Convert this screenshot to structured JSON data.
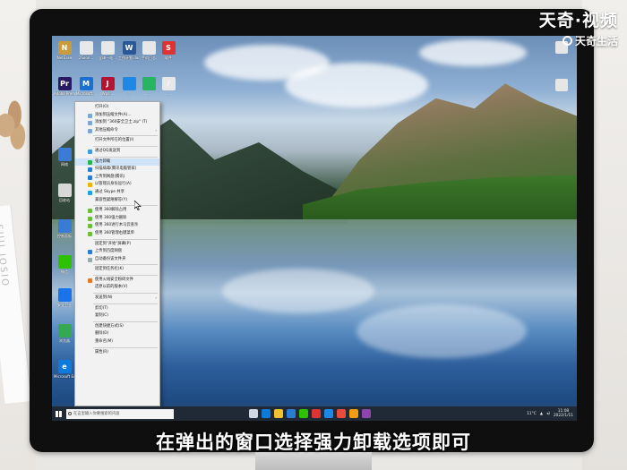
{
  "brand": {
    "logo_text": "天奇·视频",
    "sub_text": "天奇生活"
  },
  "subtitle": "在弹出的窗口选择强力卸载选项即可",
  "backdrop": {
    "paper_text": "SUJI JOSIO"
  },
  "desktop_icons": [
    {
      "label": "NetEase",
      "color": "#c89b3c",
      "glyph": "N"
    },
    {
      "label": "2Soon...",
      "color": "#e8e8e8",
      "glyph": ""
    },
    {
      "label": "全球一站...",
      "color": "#e8e8e8",
      "glyph": ""
    },
    {
      "label": "工作计划.docx",
      "color": "#2b5797",
      "glyph": "W"
    },
    {
      "label": "手机日志",
      "color": "#e8e8e8",
      "glyph": ""
    },
    {
      "label": "软件",
      "color": "#d33",
      "glyph": "S"
    },
    {
      "label": "Adobe Premie...",
      "color": "#2a1a63",
      "glyph": "Pr"
    },
    {
      "label": "Microsoft...",
      "color": "#1a6fd0",
      "glyph": "M"
    },
    {
      "label": "Wps...",
      "color": "#b5132f",
      "glyph": "J"
    },
    {
      "label": "...",
      "color": "#1e88e5",
      "glyph": ""
    },
    {
      "label": "...",
      "color": "#28b463",
      "glyph": ""
    },
    {
      "label": "...",
      "color": "#e8e8e8",
      "glyph": "/"
    },
    {
      "label": "网络",
      "color": "#3a7bd5",
      "glyph": ""
    },
    {
      "label": "回收站",
      "color": "#d8d8d8",
      "glyph": ""
    },
    {
      "label": "控制面板",
      "color": "#3a7bd5",
      "glyph": ""
    },
    {
      "label": "微信",
      "color": "#2dc100",
      "glyph": ""
    },
    {
      "label": "安全卫士",
      "color": "#1a73e8",
      "glyph": ""
    },
    {
      "label": "浏览器",
      "color": "#34a853",
      "glyph": ""
    },
    {
      "label": "Microsoft Edge",
      "color": "#0c7bdc",
      "glyph": "e"
    },
    {
      "label": "Edge",
      "color": "#0c7bdc",
      "glyph": "e"
    }
  ],
  "context_menu": {
    "items": [
      {
        "label": "打开(O)",
        "icon_color": "",
        "arrow": false,
        "sep_after": false
      },
      {
        "label": "添加到压缩文件(A)...",
        "icon_color": "#7aa7d8",
        "arrow": false,
        "sep_after": false
      },
      {
        "label": "添加到 \"360安全卫士.zip\" (T)",
        "icon_color": "#7aa7d8",
        "arrow": false,
        "sep_after": false
      },
      {
        "label": "其他压缩命令",
        "icon_color": "#7aa7d8",
        "arrow": true,
        "sep_after": true
      },
      {
        "label": "打开文件所在的位置(I)",
        "icon_color": "",
        "arrow": false,
        "sep_after": true
      },
      {
        "label": "通过QQ发送到",
        "icon_color": "#3b9de1",
        "arrow": false,
        "sep_after": true
      },
      {
        "label": "强力卸载",
        "icon_color": "#2bb34a",
        "arrow": false,
        "sep_after": false
      },
      {
        "label": "扫描病毒(腾讯电脑管家)",
        "icon_color": "#2b7cd3",
        "arrow": false,
        "sep_after": false
      },
      {
        "label": "上传到网盘(腾讯)",
        "icon_color": "#2b7cd3",
        "arrow": false,
        "sep_after": false
      },
      {
        "label": "以管理员身份运行(A)",
        "icon_color": "#f0b400",
        "arrow": false,
        "sep_after": false
      },
      {
        "label": "通过 Skype 共享",
        "icon_color": "#1ea0e3",
        "arrow": false,
        "sep_after": false
      },
      {
        "label": "兼容性疑难解答(Y)",
        "icon_color": "",
        "arrow": false,
        "sep_after": true
      },
      {
        "label": "使用 360解除占用",
        "icon_color": "#6bbf3b",
        "arrow": false,
        "sep_after": false
      },
      {
        "label": "使用 360强力删除",
        "icon_color": "#6bbf3b",
        "arrow": false,
        "sep_after": false
      },
      {
        "label": "使用 360进行木马云查杀",
        "icon_color": "#6bbf3b",
        "arrow": false,
        "sep_after": false
      },
      {
        "label": "使用 360管理右键菜单",
        "icon_color": "#6bbf3b",
        "arrow": false,
        "sep_after": true
      },
      {
        "label": "固定到\"开始\"屏幕(P)",
        "icon_color": "",
        "arrow": false,
        "sep_after": false
      },
      {
        "label": "上传到百度网盘",
        "icon_color": "#2b7cd3",
        "arrow": false,
        "sep_after": false
      },
      {
        "label": "自动备份该文件夹",
        "icon_color": "#9aa",
        "arrow": false,
        "sep_after": true
      },
      {
        "label": "固定到任务栏(K)",
        "icon_color": "",
        "arrow": false,
        "sep_after": true
      },
      {
        "label": "使用火绒安全粉碎文件",
        "icon_color": "#e07b2b",
        "arrow": false,
        "sep_after": false
      },
      {
        "label": "还原以前的版本(V)",
        "icon_color": "",
        "arrow": false,
        "sep_after": true
      },
      {
        "label": "发送到(N)",
        "icon_color": "",
        "arrow": true,
        "sep_after": true
      },
      {
        "label": "剪切(T)",
        "icon_color": "",
        "arrow": false,
        "sep_after": false
      },
      {
        "label": "复制(C)",
        "icon_color": "",
        "arrow": false,
        "sep_after": true
      },
      {
        "label": "创建快捷方式(S)",
        "icon_color": "",
        "arrow": false,
        "sep_after": false
      },
      {
        "label": "删除(D)",
        "icon_color": "",
        "arrow": false,
        "sep_after": false
      },
      {
        "label": "重命名(M)",
        "icon_color": "",
        "arrow": false,
        "sep_after": true
      },
      {
        "label": "属性(R)",
        "icon_color": "",
        "arrow": false,
        "sep_after": false
      }
    ],
    "highlight_index": 6
  },
  "taskbar": {
    "search_placeholder": "在这里输入你要搜索的内容",
    "weather": "11°C",
    "clock_time": "11:08",
    "clock_date": "2022/1/11",
    "apps": [
      {
        "name": "task-view",
        "color": "#cfd8e3"
      },
      {
        "name": "edge",
        "color": "#0c7bdc"
      },
      {
        "name": "file-explorer",
        "color": "#f1c232"
      },
      {
        "name": "store",
        "color": "#2b7cd3"
      },
      {
        "name": "wechat",
        "color": "#2dc100"
      },
      {
        "name": "wps",
        "color": "#d33"
      },
      {
        "name": "qq-browser",
        "color": "#1e88e5"
      },
      {
        "name": "music",
        "color": "#e74c3c"
      },
      {
        "name": "app-9",
        "color": "#f39c12"
      },
      {
        "name": "app-10",
        "color": "#8e44ad"
      }
    ]
  }
}
